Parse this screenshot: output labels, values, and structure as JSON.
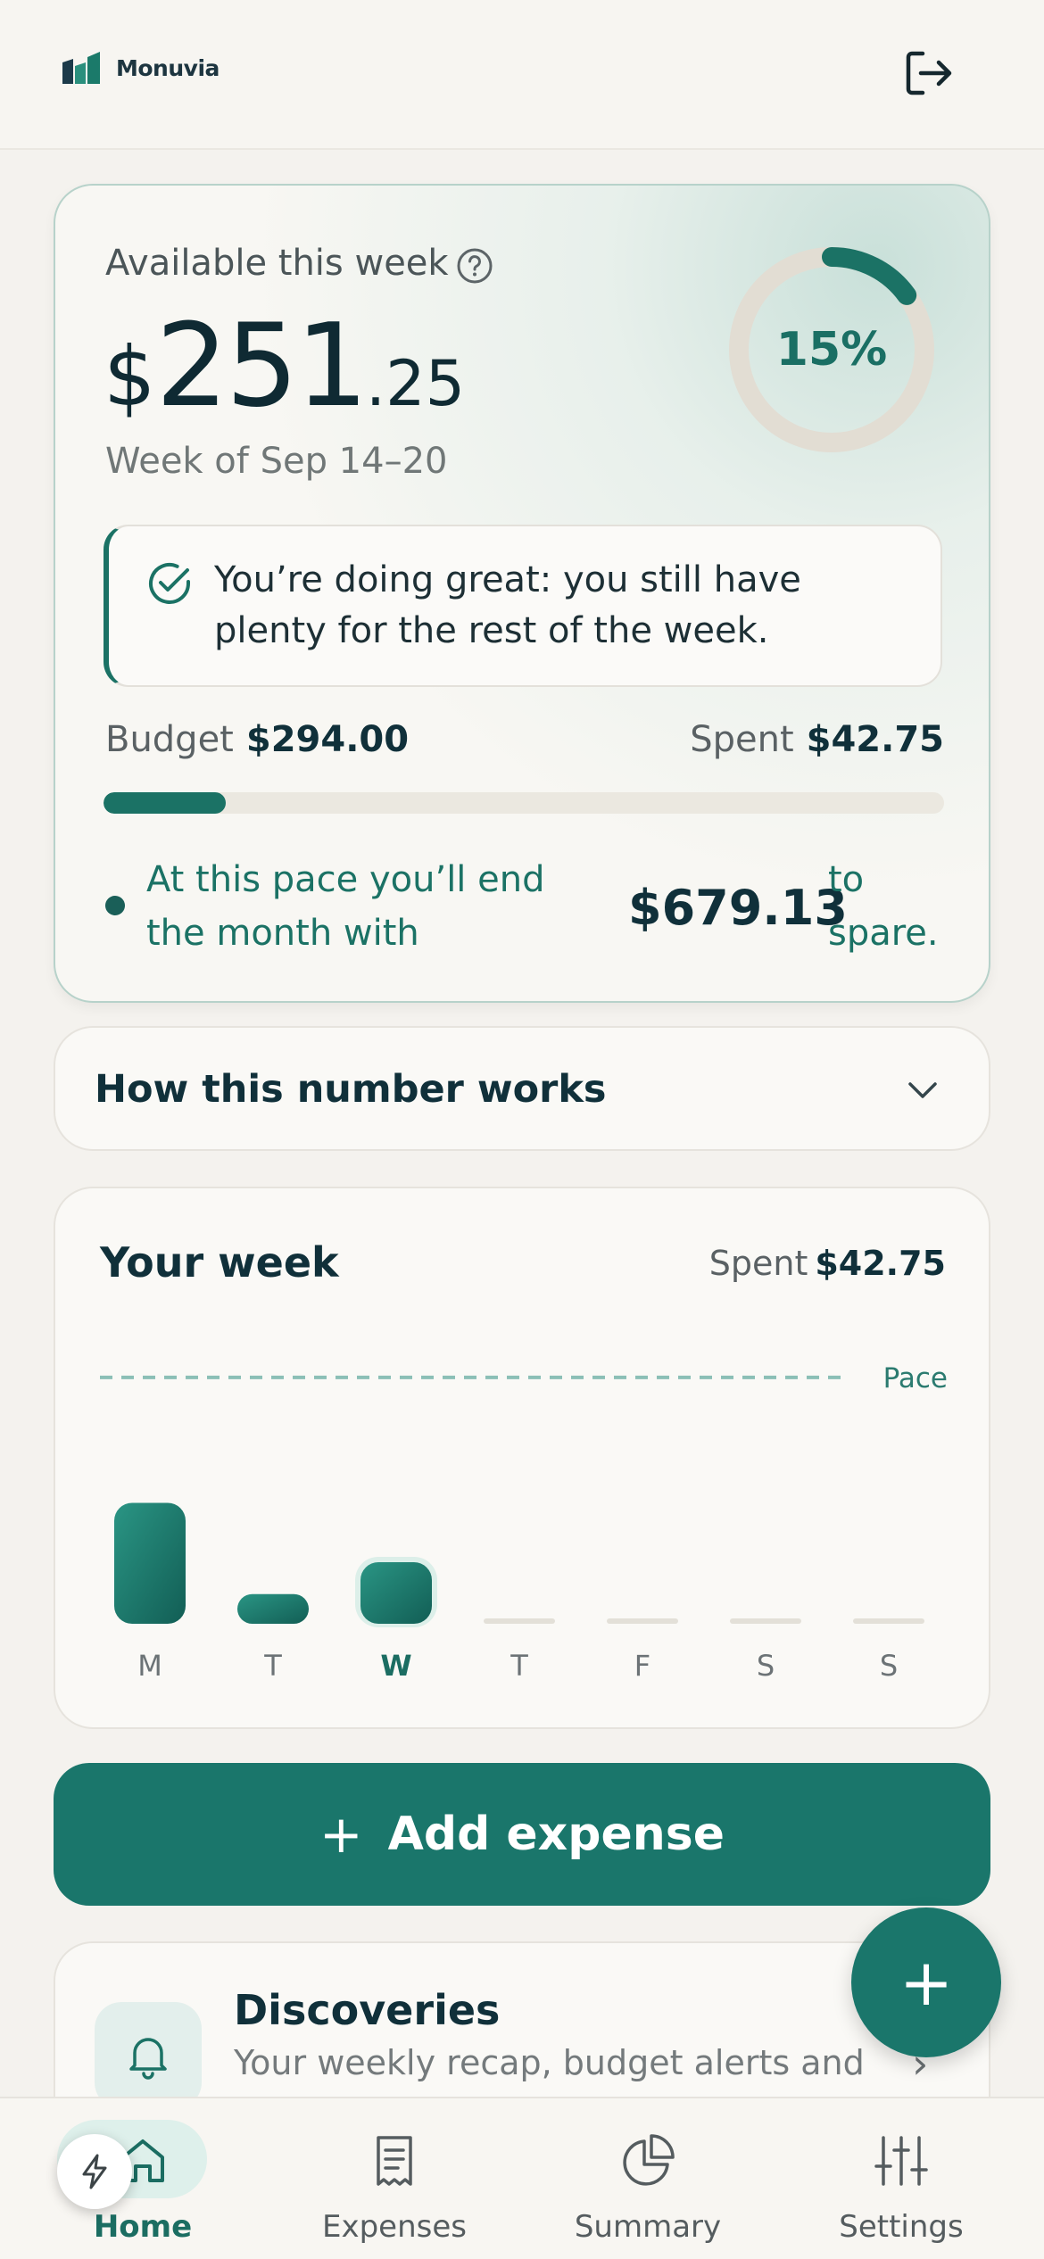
{
  "app": {
    "name": "Monuvia"
  },
  "icons": {
    "logo": "monuvia-logo-icon",
    "logout": "logout-icon",
    "help": "question-circle-icon",
    "check": "check-circle-icon",
    "chevron": "chevron-down-icon",
    "bell": "bell-icon",
    "quick": "lightning-icon"
  },
  "colors": {
    "accent": "#1b7265",
    "background": "#f4f2ee",
    "ring_track": "#e2ddd3",
    "text_dark": "#10303a"
  },
  "hero": {
    "label": "Available this week",
    "amount_currency": "$",
    "amount_int": "251",
    "amount_dec": ".25",
    "week_range": "Week of Sep 14–20",
    "ring_percent": 15,
    "ring_label": "15%",
    "callout": "You’re doing great: you still have plenty for the rest of the week.",
    "budget_label": "Budget",
    "budget_value": "$294.00",
    "spent_label": "Spent",
    "spent_value": "$42.75",
    "progress_fraction": 0.145,
    "pace_text": "At this pace you’ll end the month with",
    "pace_amount": "$679.13",
    "pace_tail": "to spare."
  },
  "accordion": {
    "title": "How this number works"
  },
  "week": {
    "title": "Your week",
    "spent_label": "Spent",
    "spent_value": "$42.75"
  },
  "chart_data": {
    "type": "bar",
    "categories": [
      "M",
      "T",
      "W",
      "T",
      "F",
      "S",
      "S"
    ],
    "values": [
      26.5,
      6.5,
      13.5,
      0,
      0,
      0,
      0
    ],
    "active_index": 2,
    "reference_line": {
      "label": "Pace",
      "value": 54
    },
    "title": "",
    "xlabel": "",
    "ylabel": "",
    "ylim": [
      0,
      70
    ],
    "grid": false
  },
  "actions": {
    "add_expense": "Add expense",
    "plus": "+"
  },
  "discoveries": {
    "title": "Discoveries",
    "subtitle": "Your weekly recap, budget alerts and",
    "arrow": "›"
  },
  "fab": {
    "label": "+"
  },
  "nav": {
    "items": [
      {
        "label": "Home",
        "icon": "home-icon"
      },
      {
        "label": "Expenses",
        "icon": "receipt-icon"
      },
      {
        "label": "Summary",
        "icon": "pie-chart-icon"
      },
      {
        "label": "Settings",
        "icon": "sliders-icon"
      }
    ]
  }
}
